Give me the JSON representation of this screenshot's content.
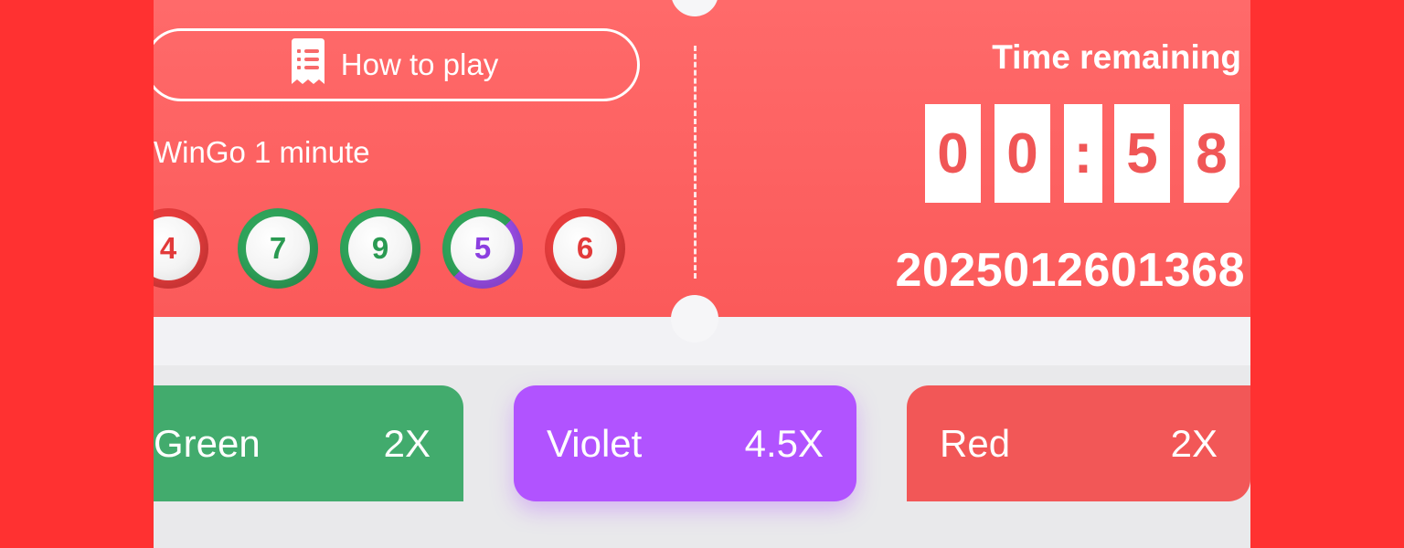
{
  "header": {
    "how_to_play_label": "How to play",
    "game_name": "WinGo 1 minute"
  },
  "last_results": [
    {
      "number": "4",
      "color": "red"
    },
    {
      "number": "7",
      "color": "green"
    },
    {
      "number": "9",
      "color": "green"
    },
    {
      "number": "5",
      "color": "green-violet"
    },
    {
      "number": "6",
      "color": "red"
    }
  ],
  "timer": {
    "label": "Time remaining",
    "digits": [
      "0",
      "0",
      ":",
      "5",
      "8"
    ],
    "period_id": "2025012601368"
  },
  "bets": [
    {
      "label": "Green",
      "multiplier": "2X",
      "color": "#42ab6d"
    },
    {
      "label": "Violet",
      "multiplier": "4.5X",
      "color": "#b153ff"
    },
    {
      "label": "Red",
      "multiplier": "2X",
      "color": "#f25757"
    }
  ],
  "icons": {
    "how_to_play": "receipt-icon"
  }
}
